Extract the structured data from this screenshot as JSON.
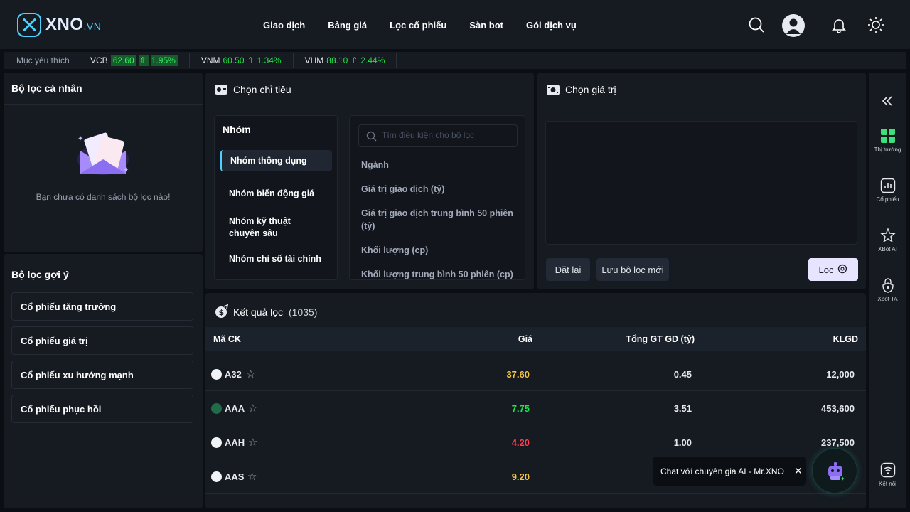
{
  "brand": {
    "name": "XNO",
    "suffix": ".VN",
    "accent": "#4fd1ff"
  },
  "nav": {
    "items": [
      "Giao dịch",
      "Bảng giá",
      "Lọc cổ phiếu",
      "Sàn bot",
      "Gói dịch vụ"
    ]
  },
  "header_icons": [
    "search-icon",
    "user-avatar",
    "bell-icon",
    "sun-icon"
  ],
  "ticker": {
    "favorites_label": "Mục yêu thích",
    "items": [
      {
        "symbol": "VCB",
        "price": "62.60",
        "change": "1.95%"
      },
      {
        "symbol": "VNM",
        "price": "60.50",
        "change": "1.34%"
      },
      {
        "symbol": "VHM",
        "price": "88.10",
        "change": "2.44%"
      }
    ]
  },
  "personal_filters": {
    "title": "Bộ lọc cá nhân",
    "empty_text": "Bạn chưa có danh sách bộ lọc nào!"
  },
  "suggested_filters": {
    "title": "Bộ lọc gợi ý",
    "items": [
      "Cổ phiếu tăng trưởng",
      "Cổ phiếu giá trị",
      "Cổ phiếu xu hướng mạnh",
      "Cổ phiếu phục hồi"
    ]
  },
  "criteria": {
    "title": "Chọn chỉ tiêu",
    "group_title": "Nhóm",
    "groups": [
      "Nhóm thông dụng",
      "Nhóm biến động giá",
      "Nhóm kỹ thuật chuyên sâu",
      "Nhóm chỉ số tài chính"
    ],
    "search_placeholder": "Tìm điều kiện cho bộ lọc",
    "items": [
      "Ngành",
      "Giá trị giao dịch (tỷ)",
      "Giá trị giao dịch trung bình 50 phiên (tỷ)",
      "Khối lượng (cp)",
      "Khối lượng trung bình 50 phiên (cp)"
    ]
  },
  "values": {
    "title": "Chọn giá trị",
    "reset_label": "Đặt lại",
    "save_label": "Lưu bộ lọc mới",
    "filter_label": "Lọc"
  },
  "results": {
    "title": "Kết quả lọc",
    "count": "(1035)",
    "columns": [
      "Mã CK",
      "Giá",
      "Tổng GT GD (tỷ)",
      "KLGD"
    ],
    "rows": [
      {
        "symbol": "A32",
        "price": "37.60",
        "price_color": "#f5c542",
        "value": "0.45",
        "volume": "12,000"
      },
      {
        "symbol": "AAA",
        "price": "7.75",
        "price_color": "#22e34a",
        "value": "3.51",
        "volume": "453,600"
      },
      {
        "symbol": "AAH",
        "price": "4.20",
        "price_color": "#ff3b4e",
        "value": "1.00",
        "volume": "237,500"
      },
      {
        "symbol": "AAS",
        "price": "9.20",
        "price_color": "#f5c542",
        "value": "",
        "volume": ""
      }
    ]
  },
  "sidebar": {
    "items": [
      "Thị trường",
      "Cổ phiếu",
      "XBot AI",
      "Xbot TA"
    ],
    "connect_label": "Kết nối"
  },
  "chat": {
    "text": "Chat với chuyên gia AI - Mr.XNO"
  }
}
